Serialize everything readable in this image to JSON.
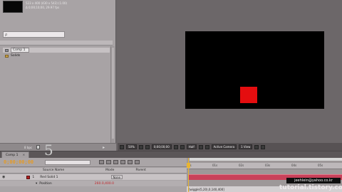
{
  "project": {
    "comp_info": [
      "523 x 400 (430 x 543) (1.00)",
      "Δ 0;00;10;00, 29.97 fps"
    ],
    "search_placeholder": "ρ",
    "items": [
      {
        "name": "Comp 1",
        "type": "comp",
        "selected": true
      },
      {
        "name": "Solids",
        "type": "folder",
        "selected": false
      }
    ],
    "bpc_label": "8 bpc"
  },
  "composition": {
    "background_color": "#000000",
    "solid_color": "#e40d0f"
  },
  "viewer_bar": {
    "zoom": "50%",
    "timecode": "0;00;00;00",
    "resolution": "Half",
    "camera": "Active Camera",
    "views": "1 View"
  },
  "timeline": {
    "tab_label": "Comp 1",
    "tab_close": "×",
    "number_overlay": "5",
    "timecode": "0;00;00;00",
    "columns": {
      "source_name": "Source Name",
      "mode": "Mode",
      "parent": "Parent"
    },
    "layer": {
      "index": "1",
      "name": "Red Solid 1",
      "parent": "None",
      "color": "#b42020"
    },
    "property": {
      "name": "Position",
      "value": "260.0,400.0"
    },
    "ruler_ticks": [
      "0s",
      "01s",
      "02s",
      "03s",
      "04s",
      "05s"
    ],
    "expression": "[wiggle(5,20),0,140,400]"
  },
  "watermark": {
    "email": "jeehlein@yahoo.co.kr",
    "site": "tutorial.tistory.com"
  }
}
